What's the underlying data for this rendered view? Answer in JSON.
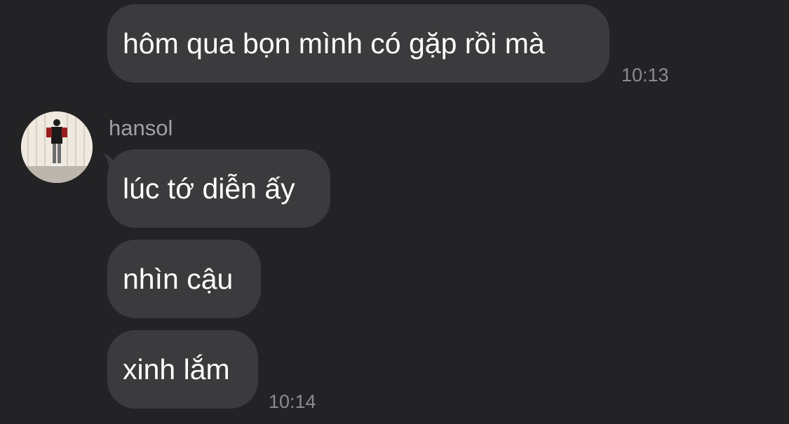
{
  "messages": [
    {
      "text": "hôm qua bọn mình có gặp rồi mà",
      "time": "10:13"
    },
    {
      "text": "lúc tớ diễn ấy"
    },
    {
      "text": "nhìn cậu"
    },
    {
      "text": "xinh lắm",
      "time": "10:14"
    }
  ],
  "sender": {
    "name": "hansol"
  },
  "colors": {
    "background": "#232325",
    "bubble": "#3b3b3d",
    "text": "#ffffff",
    "timestamp": "#8c8c90"
  }
}
